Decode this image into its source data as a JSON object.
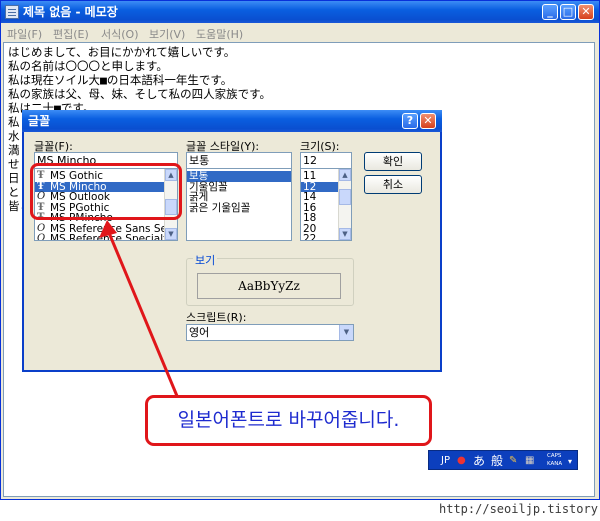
{
  "notepad": {
    "title": "제목 없음 - 메모장",
    "menu": [
      "파일(F)",
      "편집(E)",
      "서식(O)",
      "보기(V)",
      "도움말(H)"
    ],
    "lines": [
      "はじめまして、お目にかかれて嬉しいです。",
      "私の名前は〇〇〇と申します。",
      "私は現在ソイル大■の日本語科一年生です。",
      "私の家族は父、母、妹、そして私の四人家族です。",
      "私は二十■です。",
      "私                                        です。",
      "水                                        す。",
      "満                                        か。",
      "せ                                        さん話すことが必要だ",
      "日",
      "と",
      "皆と"
    ]
  },
  "font_dialog": {
    "title": "글꼴",
    "help_glyph": "?",
    "close_glyph": "✕",
    "font_label": "글꼴(F):",
    "font_value": "MS Mincho",
    "fonts": [
      {
        "name": "MS Gothic",
        "icon": "truetype-font-icon",
        "glyph": "Ŧ"
      },
      {
        "name": "MS Mincho",
        "icon": "truetype-font-icon",
        "glyph": "Ŧ",
        "selected": true
      },
      {
        "name": "MS Outlook",
        "icon": "opentype-font-icon",
        "glyph": "O"
      },
      {
        "name": "MS PGothic",
        "icon": "truetype-font-icon",
        "glyph": "Ŧ"
      },
      {
        "name": "MS PMincho",
        "icon": "truetype-font-icon",
        "glyph": "Ŧ"
      },
      {
        "name": "MS Reference Sans Se",
        "icon": "opentype-font-icon",
        "glyph": "O"
      },
      {
        "name": "MS Reference Specialty",
        "icon": "opentype-font-icon",
        "glyph": "O"
      }
    ],
    "style_label": "글꼴 스타일(Y):",
    "style_value": "보통",
    "styles": [
      {
        "name": "보통",
        "selected": true
      },
      {
        "name": "기울임꼴"
      },
      {
        "name": "굵게"
      },
      {
        "name": "굵은 기울임꼴"
      }
    ],
    "size_label": "크기(S):",
    "size_value": "12",
    "sizes": [
      {
        "name": "11"
      },
      {
        "name": "12",
        "selected": true
      },
      {
        "name": "14"
      },
      {
        "name": "16"
      },
      {
        "name": "18"
      },
      {
        "name": "20"
      },
      {
        "name": "22"
      }
    ],
    "ok_label": "확인",
    "cancel_label": "취소",
    "preview_label": "보기",
    "preview_text": "AaBbYyZz",
    "script_label": "스크립트(R):",
    "script_value": "영어"
  },
  "annotation": {
    "callout_text": "일본어폰트로 바꾸어줍니다.",
    "color": "#e0161a",
    "text_color": "#1e2bcf"
  },
  "ime": {
    "lang": "JP",
    "kana": "あ",
    "mode": "般",
    "caps": "CAPS",
    "kana_label": "KANA"
  },
  "watermark": "http://seoiljp.tistory.com"
}
